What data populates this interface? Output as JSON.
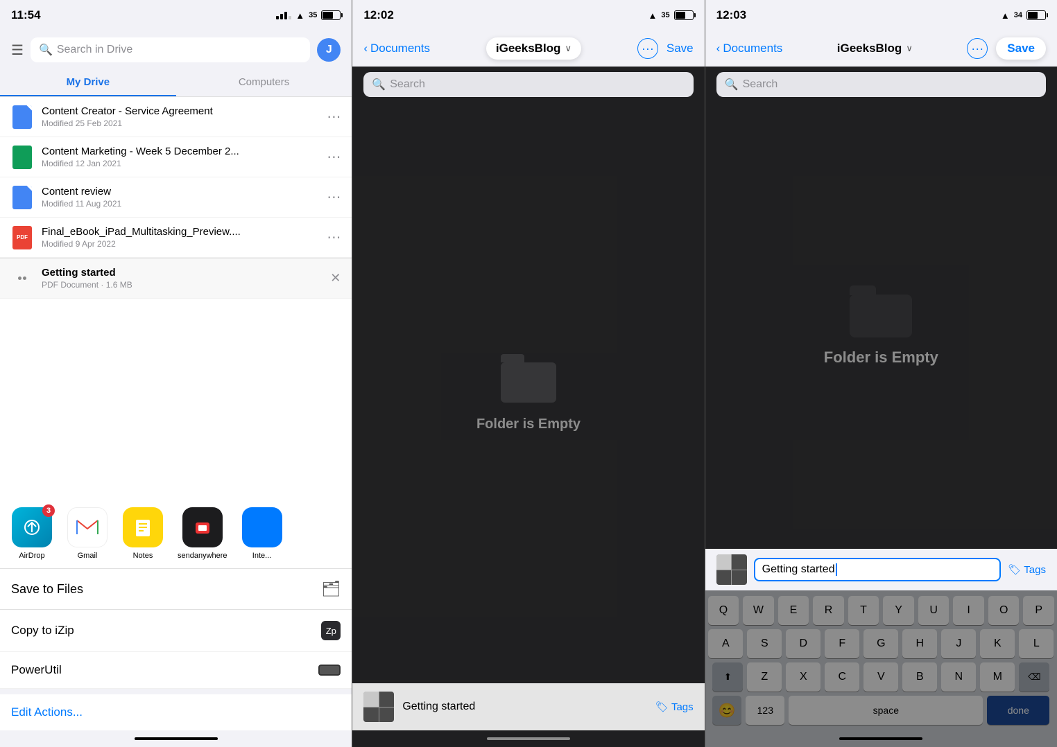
{
  "panel1": {
    "statusBar": {
      "time": "11:54",
      "battery": "35",
      "batteryFill": "60%"
    },
    "header": {
      "searchPlaceholder": "Search in Drive",
      "avatarLabel": "J"
    },
    "tabs": [
      {
        "label": "My Drive",
        "active": true
      },
      {
        "label": "Computers",
        "active": false
      }
    ],
    "files": [
      {
        "name": "Content Creator - Service Agreement",
        "meta": "Modified 25 Feb 2021",
        "type": "doc"
      },
      {
        "name": "Content Marketing - Week 5 December 2...",
        "meta": "Modified 12 Jan 2021",
        "type": "sheet"
      },
      {
        "name": "Content review",
        "meta": "Modified 11 Aug 2021",
        "type": "doc"
      },
      {
        "name": "Final_eBook_iPad_Multitasking_Preview....",
        "meta": "Modified 9 Apr 2022",
        "type": "pdf"
      }
    ],
    "pinnedFile": {
      "name": "Getting started",
      "meta": "PDF Document · 1.6 MB",
      "type": "pdf"
    },
    "shareApps": [
      {
        "name": "AirDrop",
        "type": "airdrop",
        "badge": "3"
      },
      {
        "name": "Gmail",
        "type": "gmail",
        "badge": null
      },
      {
        "name": "Notes",
        "type": "notes",
        "badge": null
      },
      {
        "name": "sendanywhere",
        "type": "sendanywhere",
        "badge": null
      },
      {
        "name": "Inte...",
        "type": "blue",
        "badge": null
      }
    ],
    "saveToFiles": "Save to Files",
    "copyToiZip": "Copy to iZip",
    "powerUtil": "PowerUtil",
    "editActions": "Edit Actions..."
  },
  "panel2": {
    "statusBar": {
      "time": "12:02",
      "battery": "35"
    },
    "nav": {
      "back": "Documents",
      "title": "iGeeksBlog",
      "saveLabel": "Save"
    },
    "searchPlaceholder": "Search",
    "emptyFolderLabel": "Folder is Empty",
    "preview": {
      "name": "Getting started",
      "tagsLabel": "Tags"
    }
  },
  "panel3": {
    "statusBar": {
      "time": "12:03",
      "battery": "34"
    },
    "nav": {
      "back": "Documents",
      "title": "iGeeksBlog",
      "saveLabel": "Save"
    },
    "searchPlaceholder": "Search",
    "emptyFolderLabel": "Folder is Empty",
    "filename": "Getting started",
    "tagsLabel": "Tags",
    "keyboard": {
      "rows": [
        [
          "Q",
          "W",
          "E",
          "R",
          "T",
          "Y",
          "U",
          "I",
          "O",
          "P"
        ],
        [
          "A",
          "S",
          "D",
          "F",
          "G",
          "H",
          "J",
          "K",
          "L"
        ],
        [
          "Z",
          "X",
          "C",
          "V",
          "B",
          "N",
          "M"
        ]
      ],
      "bottomRow": {
        "numbers": "123",
        "space": "space",
        "done": "done"
      }
    }
  }
}
